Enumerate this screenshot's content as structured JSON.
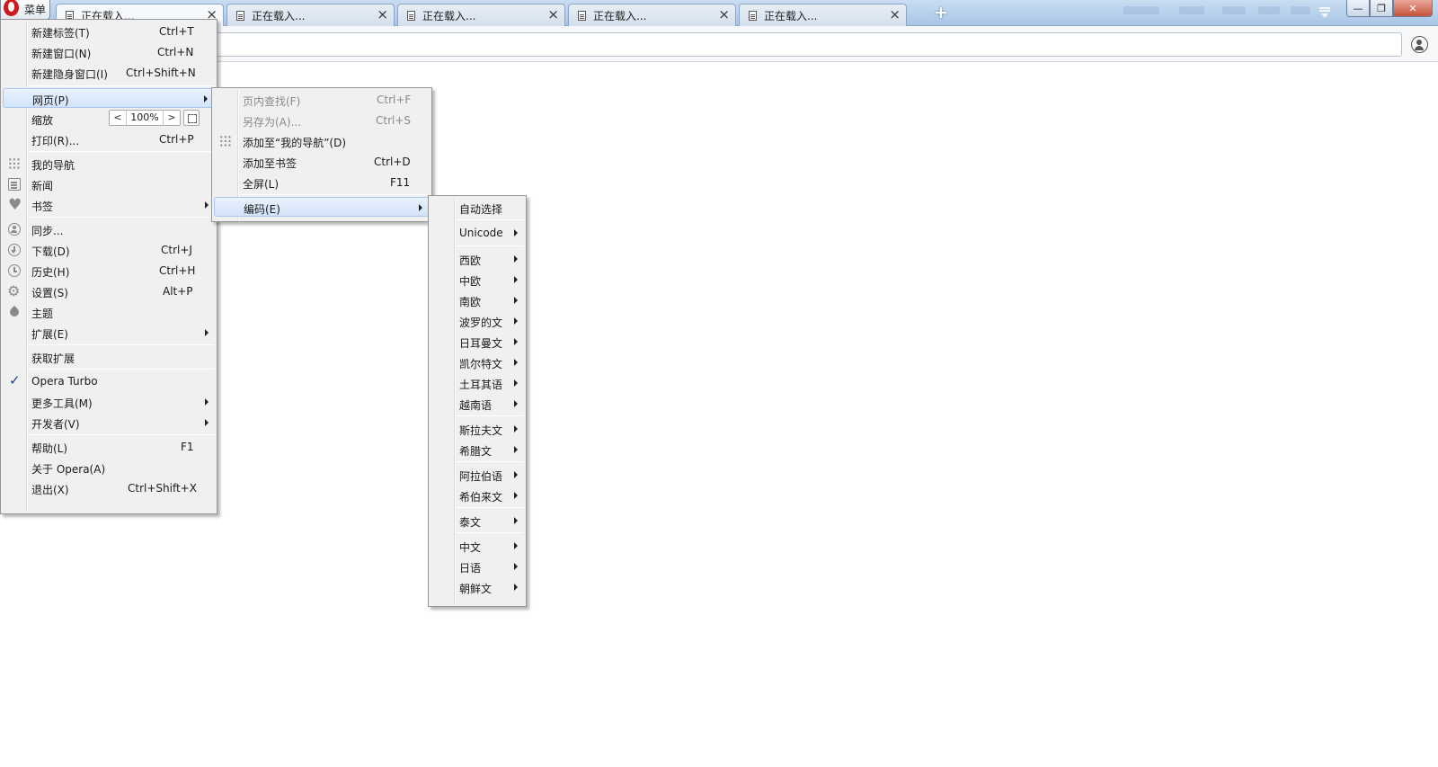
{
  "menu_button": {
    "label": "菜单"
  },
  "tabs": [
    {
      "title": "正在载入...",
      "close": "×"
    },
    {
      "title": "正在载入...",
      "close": "×"
    },
    {
      "title": "正在载入...",
      "close": "×"
    },
    {
      "title": "正在载入...",
      "close": "×"
    },
    {
      "title": "正在载入...",
      "close": "×"
    }
  ],
  "new_tab": "+",
  "window": {
    "minimize": "—",
    "maximize": "❐",
    "close": "✕"
  },
  "main_menu": {
    "new_tab": {
      "label": "新建标签(T)",
      "shortcut": "Ctrl+T"
    },
    "new_window": {
      "label": "新建窗口(N)",
      "shortcut": "Ctrl+N"
    },
    "new_private": {
      "label": "新建隐身窗口(I)",
      "shortcut": "Ctrl+Shift+N"
    },
    "page": {
      "label": "网页(P)"
    },
    "zoom": {
      "label": "缩放",
      "value": "100%",
      "dec": "<",
      "inc": ">"
    },
    "print": {
      "label": "打印(R)...",
      "shortcut": "Ctrl+P"
    },
    "speed_dial": {
      "label": "我的导航",
      "icon": "grid-icon"
    },
    "news": {
      "label": "新闻",
      "icon": "news-icon"
    },
    "bookmarks": {
      "label": "书签",
      "icon": "heart-icon"
    },
    "sync": {
      "label": "同步...",
      "icon": "user-icon"
    },
    "downloads": {
      "label": "下载(D)",
      "shortcut": "Ctrl+J",
      "icon": "download-icon"
    },
    "history": {
      "label": "历史(H)",
      "shortcut": "Ctrl+H",
      "icon": "clock-icon"
    },
    "settings": {
      "label": "设置(S)",
      "shortcut": "Alt+P",
      "icon": "gear-icon"
    },
    "themes": {
      "label": "主题",
      "icon": "drop-icon"
    },
    "extensions": {
      "label": "扩展(E)"
    },
    "get_extensions": {
      "label": "获取扩展"
    },
    "opera_turbo": {
      "label": "Opera Turbo",
      "checked": true
    },
    "more_tools": {
      "label": "更多工具(M)"
    },
    "developer": {
      "label": "开发者(V)"
    },
    "help": {
      "label": "帮助(L)",
      "shortcut": "F1"
    },
    "about": {
      "label": "关于 Opera(A)"
    },
    "exit": {
      "label": "退出(X)",
      "shortcut": "Ctrl+Shift+X"
    }
  },
  "page_menu": {
    "find": {
      "label": "页内查找(F)",
      "shortcut": "Ctrl+F"
    },
    "save_as": {
      "label": "另存为(A)...",
      "shortcut": "Ctrl+S"
    },
    "add_speed_dial": {
      "label": "添加至“我的导航”(D)"
    },
    "add_bookmark": {
      "label": "添加至书签",
      "shortcut": "Ctrl+D"
    },
    "fullscreen": {
      "label": "全屏(L)",
      "shortcut": "F11"
    },
    "encoding": {
      "label": "编码(E)"
    }
  },
  "encoding_menu": {
    "auto": "自动选择",
    "unicode": "Unicode",
    "western": "西欧",
    "central": "中欧",
    "southern": "南欧",
    "baltic": "波罗的文",
    "germanic": "日耳曼文",
    "celtic": "凯尔特文",
    "turkish": "土耳其语",
    "vietnamese": "越南语",
    "slavic": "斯拉夫文",
    "greek": "希腊文",
    "arabic": "阿拉伯语",
    "hebrew": "希伯来文",
    "thai": "泰文",
    "chinese": "中文",
    "japanese": "日语",
    "korean": "朝鲜文"
  }
}
